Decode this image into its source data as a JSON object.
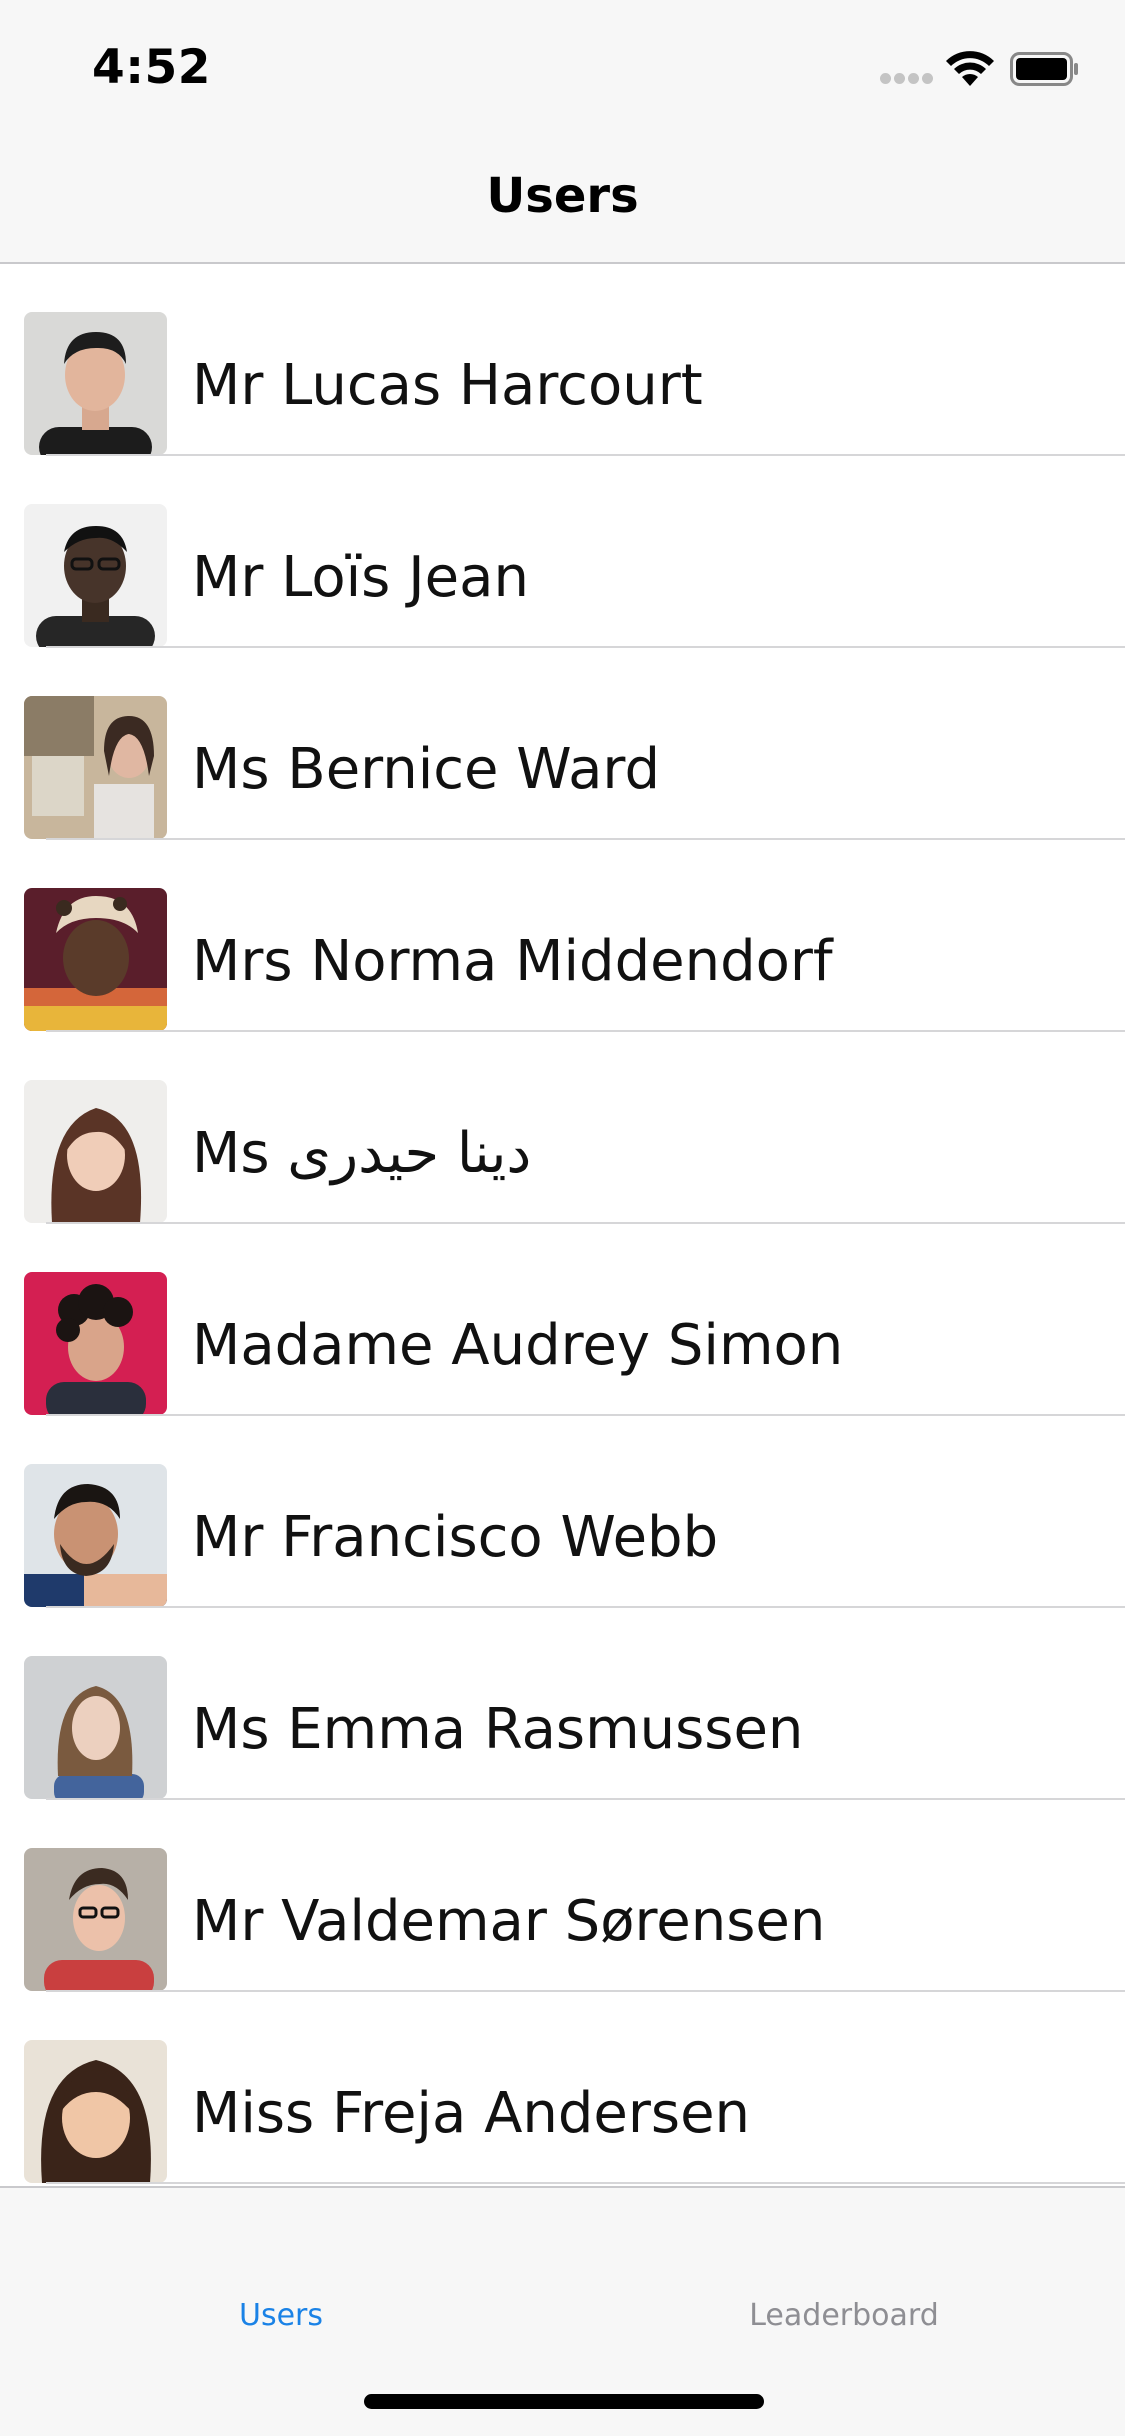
{
  "status_bar": {
    "time": "4:52",
    "icons": [
      "signal-icon",
      "wifi-icon",
      "battery-icon"
    ]
  },
  "nav": {
    "title": "Users"
  },
  "users": [
    {
      "name": "Mr Lucas Harcourt"
    },
    {
      "name": "Mr Loïs Jean"
    },
    {
      "name": "Ms Bernice Ward"
    },
    {
      "name": "Mrs Norma Middendorf"
    },
    {
      "name": "Ms دینا حیدری"
    },
    {
      "name": "Madame Audrey Simon"
    },
    {
      "name": "Mr Francisco Webb"
    },
    {
      "name": "Ms Emma Rasmussen"
    },
    {
      "name": "Mr Valdemar Sørensen"
    },
    {
      "name": "Miss Freja Andersen"
    }
  ],
  "tabs": [
    {
      "label": "Users",
      "selected": true
    },
    {
      "label": "Leaderboard",
      "selected": false
    }
  ],
  "colors": {
    "accent": "#1a82e6",
    "tab_inactive": "#8e8e93"
  }
}
